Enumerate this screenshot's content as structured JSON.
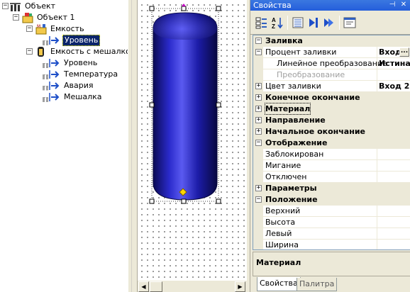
{
  "tree": {
    "items": [
      {
        "label": "Объект",
        "level": 0,
        "expander": "−",
        "icon": "object-root-icon",
        "selected": false
      },
      {
        "label": "Объект 1",
        "level": 1,
        "expander": "−",
        "icon": "object-folder-icon",
        "selected": false
      },
      {
        "label": "Емкость",
        "level": 2,
        "expander": "−",
        "icon": "tank-icon",
        "selected": false
      },
      {
        "label": "Уровень",
        "level": 3,
        "expander": "",
        "icon": "signal-arrow-icon",
        "selected": true
      },
      {
        "label": "Емкость с мешалкой",
        "level": 2,
        "expander": "−",
        "icon": "mixer-tank-icon",
        "selected": false
      },
      {
        "label": "Уровень",
        "level": 3,
        "expander": "",
        "icon": "signal-arrow-icon",
        "selected": false
      },
      {
        "label": "Температура",
        "level": 3,
        "expander": "",
        "icon": "signal-arrow-icon",
        "selected": false
      },
      {
        "label": "Авария",
        "level": 3,
        "expander": "",
        "icon": "signal-arrow-icon",
        "selected": false
      },
      {
        "label": "Мешалка",
        "level": 3,
        "expander": "",
        "icon": "signal-arrow-icon",
        "selected": false
      }
    ]
  },
  "designer": {
    "shape": "tank-cylinder",
    "tank_color": "#1a1a9e"
  },
  "props": {
    "title": "Свойства",
    "title_buttons": [
      "pin-icon",
      "close-icon"
    ],
    "toolbar": [
      "categorized-icon",
      "alphabetical-icon",
      "properties-icon",
      "events-right-icon",
      "events-both-icon",
      "property-pages-icon"
    ],
    "rows": [
      {
        "type": "cat",
        "expander": "−",
        "name": "Заливка",
        "value": ""
      },
      {
        "type": "prop",
        "expander": "−",
        "name": "Процент заливки",
        "value": "Вход",
        "button": "..."
      },
      {
        "type": "prop",
        "indent": true,
        "name": "Линейное преобразование",
        "value": "Истина"
      },
      {
        "type": "prop",
        "indent": true,
        "disabled": true,
        "name": "Преобразование",
        "value": ""
      },
      {
        "type": "prop",
        "expander": "+",
        "name": "Цвет заливки",
        "value": "Вход 2"
      },
      {
        "type": "cat",
        "expander": "+",
        "name": "Конечное окончание",
        "value": ""
      },
      {
        "type": "cat",
        "expander": "+",
        "name": "Материал",
        "value": "",
        "focused": true
      },
      {
        "type": "cat",
        "expander": "+",
        "name": "Направление",
        "value": ""
      },
      {
        "type": "cat",
        "expander": "+",
        "name": "Начальное окончание",
        "value": ""
      },
      {
        "type": "cat",
        "expander": "−",
        "name": "Отображение",
        "value": ""
      },
      {
        "type": "prop",
        "name": "Заблокирован",
        "value": ""
      },
      {
        "type": "prop",
        "name": "Мигание",
        "value": ""
      },
      {
        "type": "prop",
        "name": "Отключен",
        "value": ""
      },
      {
        "type": "cat",
        "expander": "+",
        "name": "Параметры",
        "value": ""
      },
      {
        "type": "cat",
        "expander": "−",
        "name": "Положение",
        "value": ""
      },
      {
        "type": "prop",
        "name": "Верхний",
        "value": ""
      },
      {
        "type": "prop",
        "name": "Высота",
        "value": ""
      },
      {
        "type": "prop",
        "name": "Левый",
        "value": ""
      },
      {
        "type": "prop",
        "name": "Ширина",
        "value": ""
      }
    ],
    "description": "Материал",
    "tabs": [
      {
        "label": "Свойства",
        "active": true
      },
      {
        "label": "Палитра",
        "active": false
      }
    ]
  }
}
